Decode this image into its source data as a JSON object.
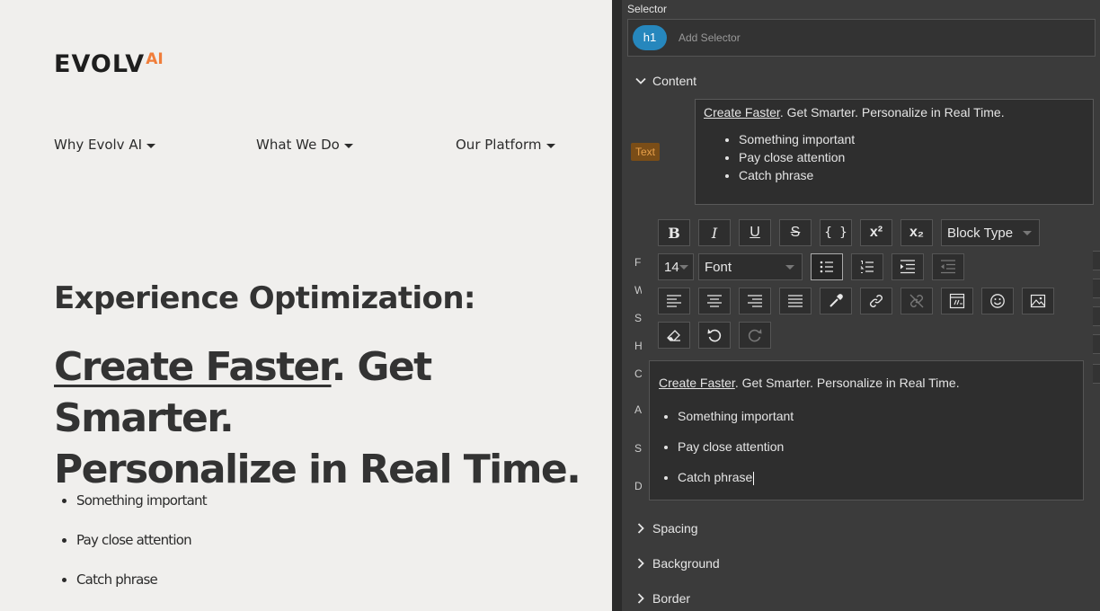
{
  "preview": {
    "logo_text": "EVOLV",
    "logo_sup": "AI",
    "nav": [
      {
        "label": "Why Evolv AI"
      },
      {
        "label": "What We Do"
      },
      {
        "label": "Our Platform"
      }
    ],
    "heading_sub": "Experience Optimization:",
    "heading_link": "Create Faster",
    "heading_rest_line1": ". Get Smarter.",
    "heading_line2": "Personalize in Real Time.",
    "bullets": [
      "Something important",
      "Pay close attention",
      "Catch phrase"
    ]
  },
  "panel": {
    "selector_label": "Selector",
    "selector_tag": "h1",
    "add_selector_placeholder": "Add Selector",
    "sections": {
      "content": "Content",
      "spacing": "Spacing",
      "background": "Background",
      "border": "Border"
    },
    "text_badge": "Text",
    "content_link": "Create Faster",
    "content_rest": ". Get Smarter. Personalize in Real Time.",
    "content_bullets": [
      "Something important",
      "Pay close attention",
      "Catch phrase"
    ],
    "side_letters": [
      "F",
      "W",
      "S",
      "H",
      "C",
      "A",
      "S",
      "D"
    ]
  },
  "rte": {
    "toolbar": {
      "block_type": "Block Type",
      "font_size": "14",
      "font": "Font",
      "icons": [
        "bold-icon",
        "italic-icon",
        "underline-icon",
        "strikethrough-icon",
        "code-icon",
        "superscript-icon",
        "subscript-icon",
        "unordered-list-icon",
        "ordered-list-icon",
        "indent-icon",
        "outdent-icon",
        "align-left-icon",
        "align-center-icon",
        "align-right-icon",
        "align-justify-icon",
        "color-picker-icon",
        "link-icon",
        "unlink-icon",
        "embed-icon",
        "emoji-icon",
        "image-icon",
        "eraser-icon",
        "undo-icon",
        "redo-icon"
      ]
    },
    "link_text": "Create Faster",
    "rest_text": ". Get Smarter. Personalize in Real Time.",
    "bullets": [
      "Something important",
      "Pay close attention",
      "Catch phrase"
    ]
  },
  "colors": {
    "accent_blue": "#2687bd",
    "logo_orange": "#f07d3a",
    "badge_orange": "#e8a04a"
  }
}
